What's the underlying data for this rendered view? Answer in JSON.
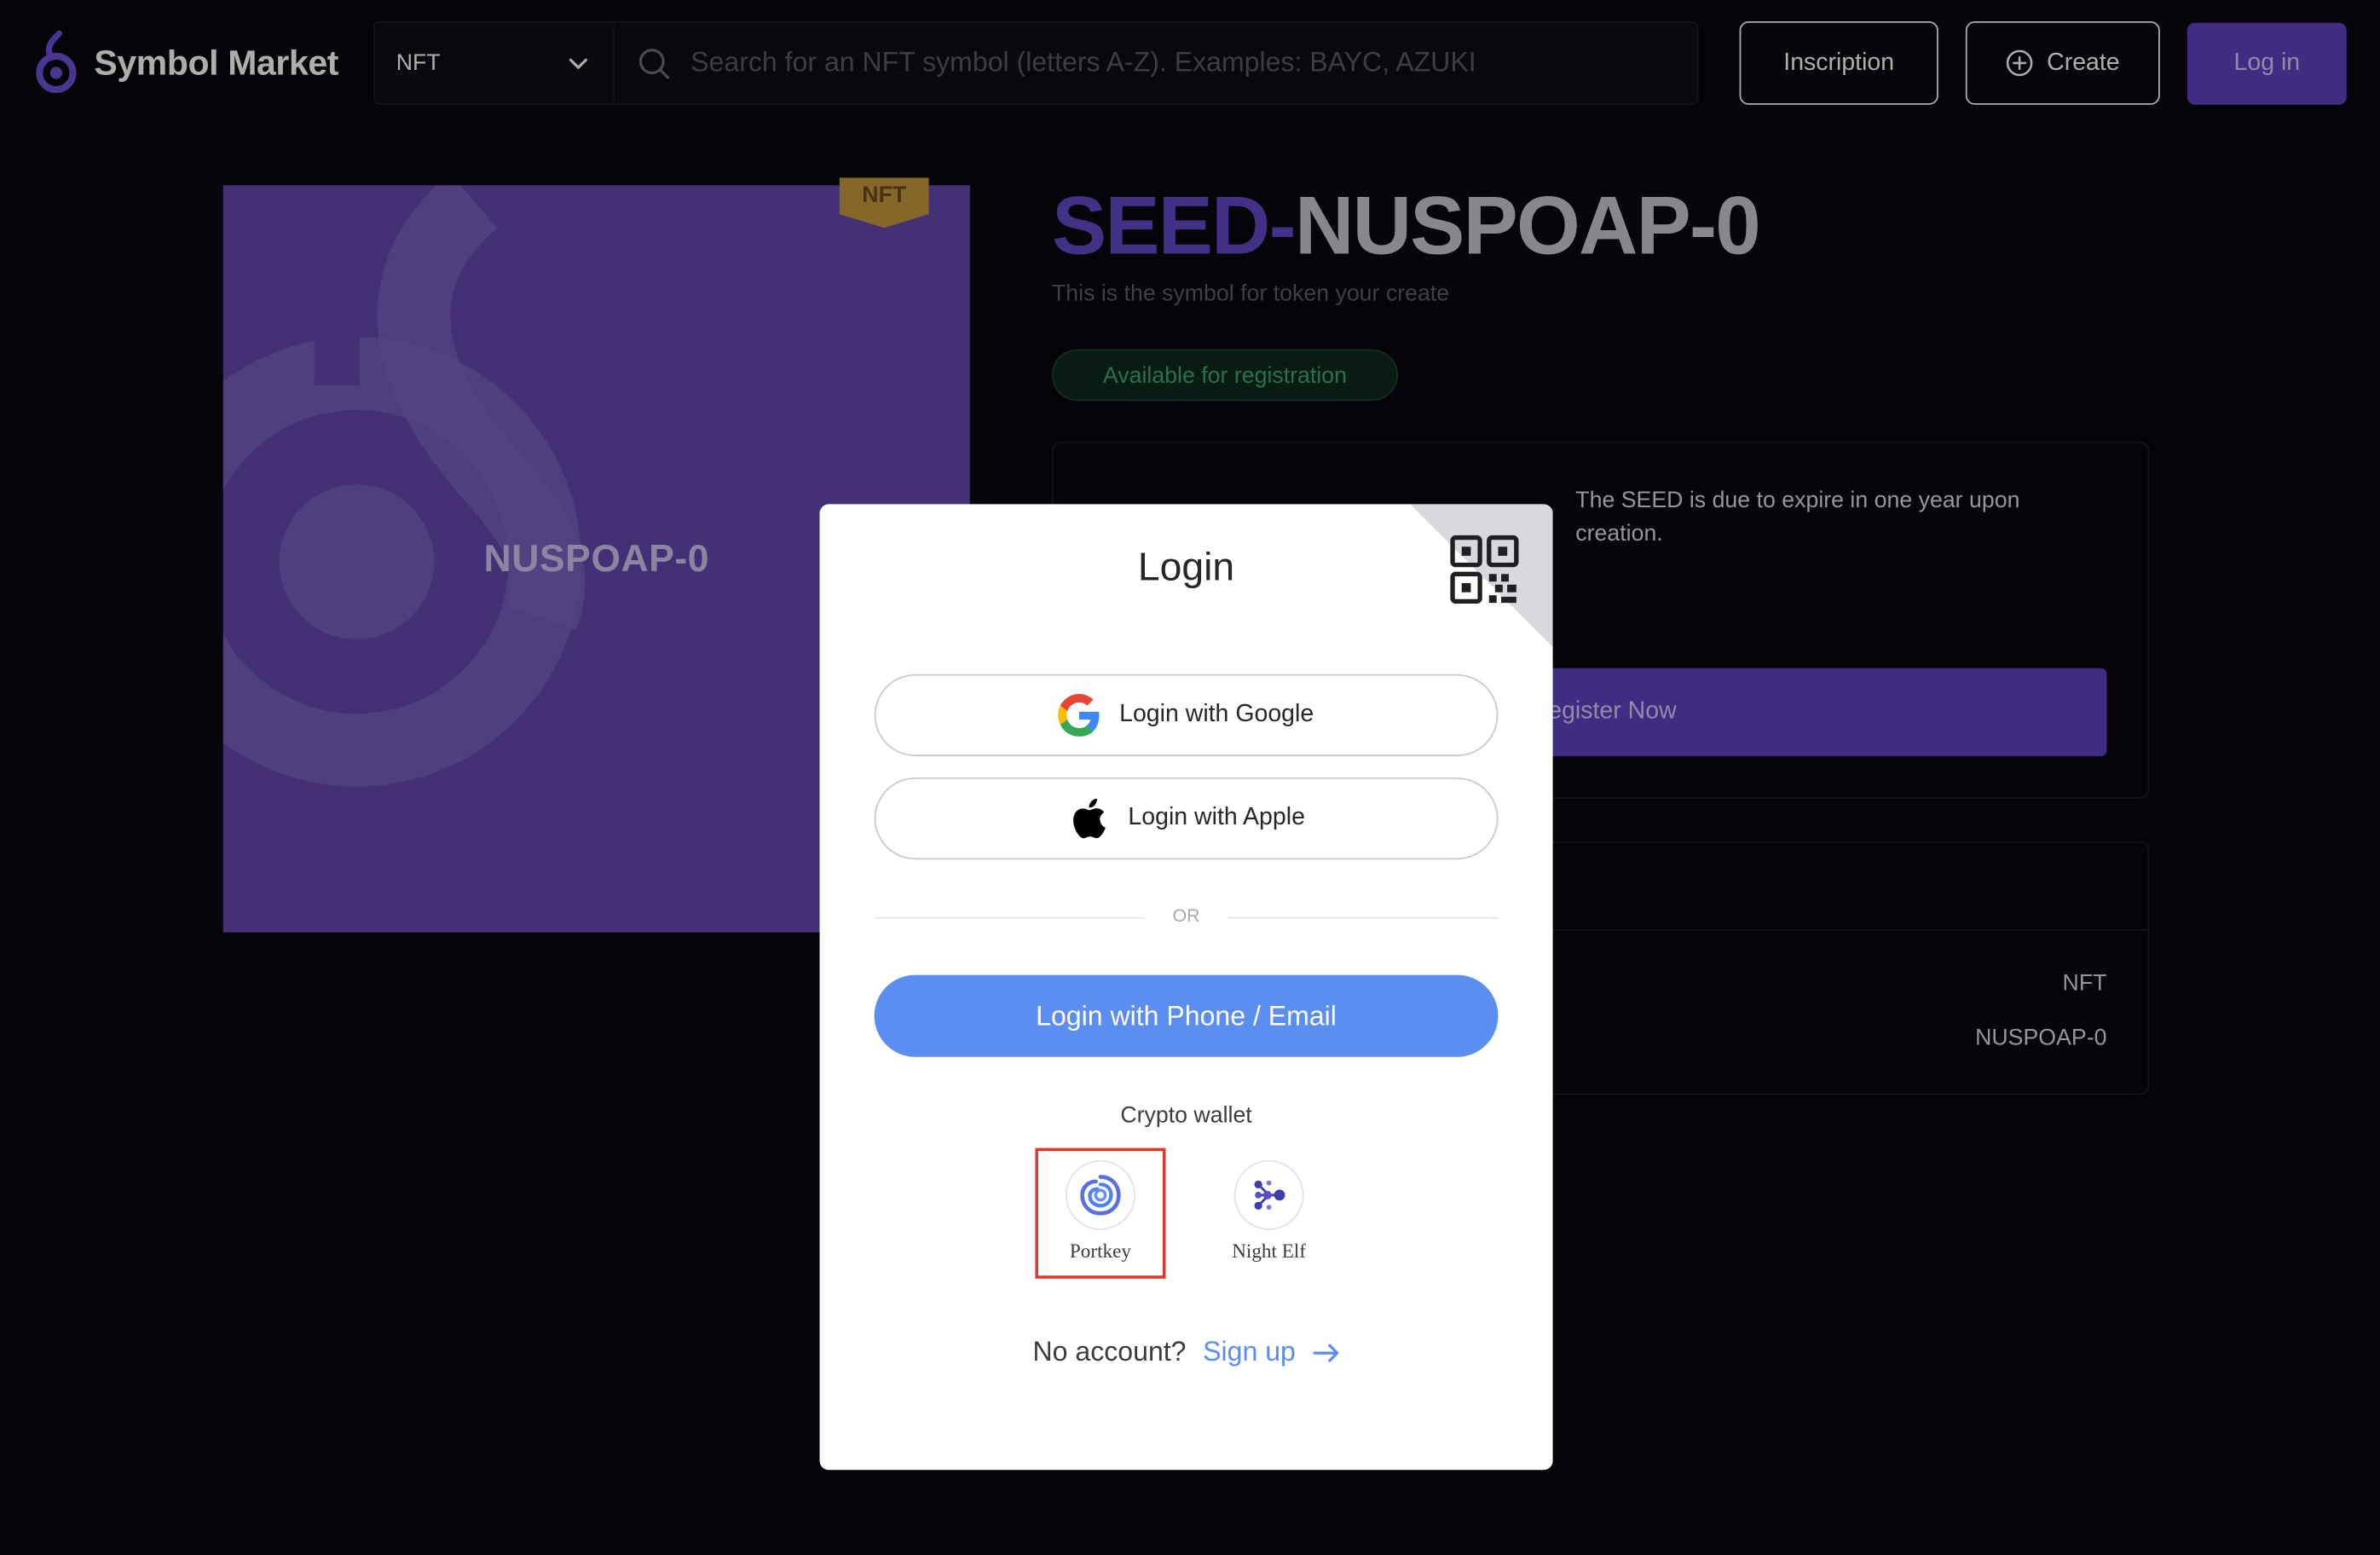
{
  "header": {
    "logo_text": "Symbol Market",
    "select_value": "NFT",
    "search_placeholder": "Search for an NFT symbol (letters A-Z). Examples: BAYC, AZUKI",
    "inscription_label": "Inscription",
    "create_label": "Create",
    "login_label": "Log in"
  },
  "nft_card": {
    "label": "NUSPOAP-0",
    "badge": "NFT"
  },
  "symbol": {
    "prefix": "SEED-",
    "name": "NUSPOAP-0",
    "subtitle": "This is the symbol for token your create",
    "status": "Available for registration",
    "expire_note": "The SEED is due to expire in one year upon creation.",
    "register_label": "egister Now"
  },
  "details": {
    "type_value": "NFT",
    "symbol_value": "NUSPOAP-0"
  },
  "login_modal": {
    "title": "Login",
    "google_label": "Login with Google",
    "apple_label": "Login with Apple",
    "or_text": "OR",
    "phone_email_label": "Login with Phone / Email",
    "crypto_wallet_label": "Crypto wallet",
    "wallets": [
      {
        "name": "Portkey",
        "icon": "portkey-icon",
        "highlighted": true
      },
      {
        "name": "Night Elf",
        "icon": "night-elf-icon",
        "highlighted": false
      }
    ],
    "no_account_text": "No account?",
    "signup_label": "Sign up"
  },
  "colors": {
    "background": "#08070d",
    "brand_purple": "#6141c1",
    "nft_card": "#6447ad",
    "status_green": "#3ea56e",
    "login_blue": "#5b8ef0",
    "highlight_red": "#e0382f"
  }
}
